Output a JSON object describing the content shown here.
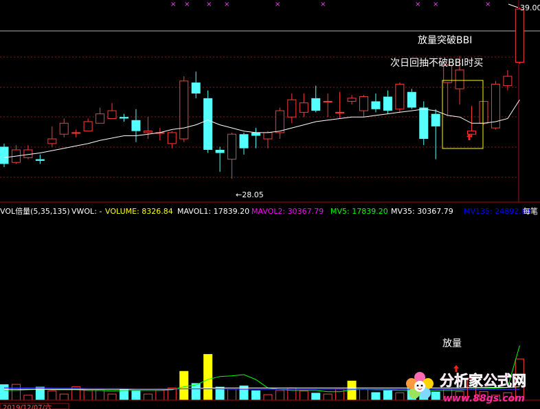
{
  "colors": {
    "up": "#ff3b3b",
    "down": "#54ffff",
    "bbi": "#ffffff",
    "vol_highlight": "#ffff00",
    "mavol1": "#ffffff",
    "mavol2": "#ff00ff",
    "mv5": "#00ff00",
    "mv35": "#ffffff",
    "mv135": "#0000ff",
    "label_yellow": "#ffff00",
    "annotation_box": "#ffff00",
    "signal_arrow": "#ff2020",
    "grid_dash": "#8a1a1a",
    "panel_border": "#a01010"
  },
  "price_panel": {
    "high_label": "39.00",
    "low_label": "←28.05",
    "top_markers": [
      "×",
      "×",
      "×",
      "×",
      "×",
      "×",
      "×",
      "×",
      "×"
    ],
    "annotation_breakout": "放量突破BBI",
    "annotation_pullback": "次日回抽不破BBI时买"
  },
  "volume_panel": {
    "indicator_name": "VOL倍量(5,35,135)",
    "legend": [
      {
        "text": "VWOL: -",
        "color": "#ffffff"
      },
      {
        "text": "VOLUME: 8326.84",
        "color": "#ffff00"
      },
      {
        "text": "MAVOL1: 17839.20",
        "color": "#ffffff"
      },
      {
        "text": "MAVOL2: 30367.79",
        "color": "#ff00ff"
      },
      {
        "text": "MV5: 17839.20",
        "color": "#00ff00"
      },
      {
        "text": "MV35: 30367.79",
        "color": "#ffffff"
      },
      {
        "text": "MV135: 24892.84",
        "color": "#0000ff"
      },
      {
        "text": "每笔",
        "color": "#ffffff"
      }
    ],
    "annotation_volume": "放量",
    "date_label": "2019/12/07/六"
  },
  "watermark": {
    "site_name": "分析家公式网",
    "site_url": "www.88gs.com"
  },
  "chart_data": [
    {
      "type": "candlestick",
      "title": "",
      "ylim": [
        27.0,
        39.3
      ],
      "x": [
        0,
        1,
        2,
        3,
        4,
        5,
        6,
        7,
        8,
        9,
        10,
        11,
        12,
        13,
        14,
        15,
        16,
        17,
        18,
        19,
        20,
        21,
        22,
        23,
        24,
        25,
        26,
        27,
        28,
        29,
        30,
        31,
        32,
        33,
        34,
        35,
        36,
        37,
        38,
        39,
        40,
        41,
        42,
        43
      ],
      "open": [
        30.1,
        29.1,
        29.4,
        29.3,
        30.3,
        30.9,
        31.0,
        31.1,
        31.6,
        31.9,
        32.0,
        31.8,
        31.0,
        31.0,
        30.3,
        30.6,
        34.2,
        33.2,
        29.9,
        29.3,
        30.9,
        31.0,
        30.6,
        31.0,
        32.0,
        32.3,
        33.2,
        33.0,
        32.3,
        33.0,
        32.4,
        33.0,
        33.3,
        32.5,
        33.6,
        32.6,
        32.2,
        34.2,
        33.8,
        30.9,
        31.6,
        31.3,
        34.0,
        35.5
      ],
      "close": [
        29.0,
        29.9,
        29.9,
        29.2,
        30.6,
        31.6,
        31.0,
        31.7,
        32.2,
        32.4,
        31.9,
        31.1,
        31.1,
        31.0,
        31.0,
        34.3,
        33.5,
        29.9,
        29.7,
        30.9,
        30.0,
        30.8,
        31.0,
        32.4,
        33.1,
        32.9,
        32.4,
        33.0,
        32.3,
        33.2,
        33.3,
        32.5,
        32.4,
        34.1,
        32.6,
        30.6,
        31.4,
        35.3,
        35.0,
        31.1,
        33.0,
        34.1,
        34.6,
        38.9
      ],
      "high": [
        30.3,
        30.2,
        30.2,
        29.6,
        31.4,
        31.9,
        31.2,
        31.9,
        32.6,
        32.9,
        32.2,
        32.5,
        32.0,
        31.3,
        31.1,
        34.6,
        34.9,
        33.7,
        30.1,
        31.0,
        31.0,
        31.3,
        31.1,
        32.6,
        33.5,
        33.5,
        34.0,
        33.5,
        33.6,
        33.4,
        33.4,
        33.5,
        33.7,
        34.2,
        33.8,
        33.0,
        32.5,
        35.4,
        35.9,
        32.7,
        33.0,
        34.3,
        35.0,
        39.0
      ],
      "low": [
        28.8,
        29.0,
        29.3,
        29.0,
        30.1,
        30.7,
        30.7,
        31.1,
        31.6,
        31.9,
        31.7,
        30.4,
        30.6,
        30.5,
        30.0,
        30.4,
        33.2,
        29.7,
        28.5,
        28.05,
        29.6,
        30.0,
        30.0,
        30.6,
        31.6,
        32.0,
        32.3,
        32.0,
        31.9,
        32.8,
        32.0,
        32.3,
        32.2,
        32.3,
        32.5,
        30.2,
        29.3,
        32.1,
        32.8,
        30.7,
        31.5,
        31.2,
        33.7,
        35.4
      ],
      "series": [
        {
          "name": "",
          "kind": "line",
          "values": [
            29.4,
            29.5,
            29.6,
            29.7,
            29.85,
            30.0,
            30.15,
            30.3,
            30.5,
            30.65,
            30.8,
            30.8,
            30.9,
            31.0,
            31.2,
            31.3,
            31.5,
            31.8,
            31.5,
            31.3,
            31.1,
            31.0,
            31.0,
            31.1,
            31.3,
            31.5,
            31.7,
            31.8,
            31.9,
            32.0,
            32.0,
            32.1,
            32.2,
            32.3,
            32.4,
            32.5,
            32.4,
            32.1,
            32.0,
            31.6,
            31.6,
            31.7,
            31.9,
            33.1
          ]
        }
      ],
      "annotations": [
        {
          "text": "放量突破BBI"
        },
        {
          "text": "次日回抽不破BBI时买"
        }
      ]
    },
    {
      "type": "bar",
      "title": "",
      "ylim": [
        0,
        30
      ],
      "x": [
        0,
        1,
        2,
        3,
        4,
        5,
        6,
        7,
        8,
        9,
        10,
        11,
        12,
        13,
        14,
        15,
        16,
        17,
        18,
        19,
        20,
        21,
        22,
        23,
        24,
        25,
        26,
        27,
        28,
        29,
        30,
        31,
        32,
        33,
        34,
        35,
        36,
        37,
        38,
        39,
        40,
        41,
        42,
        43
      ],
      "values": [
        2.6,
        2.6,
        0.8,
        2.2,
        1.5,
        1.0,
        2.2,
        1.6,
        1.6,
        1.0,
        1.8,
        1.6,
        1.0,
        1.6,
        2.0,
        4.8,
        2.8,
        7.6,
        2.2,
        1.8,
        2.4,
        1.6,
        0.9,
        1.6,
        2.0,
        1.5,
        1.2,
        1.0,
        1.8,
        3.2,
        1.8,
        1.3,
        1.6,
        1.2,
        2.4,
        1.5,
        1.4,
        1.8,
        1.4,
        3.6,
        1.4,
        0.8,
        1.2,
        6.8
      ],
      "highlight_indices": [
        15,
        17,
        29
      ],
      "series": [
        {
          "name": "MV5",
          "kind": "line",
          "values": [
            1.6,
            1.6,
            1.7,
            1.8,
            1.7,
            1.7,
            1.7,
            1.6,
            1.6,
            1.5,
            1.6,
            1.6,
            1.6,
            1.6,
            1.7,
            2.2,
            2.5,
            3.4,
            3.9,
            4.0,
            4.2,
            3.4,
            2.0,
            1.8,
            1.6,
            1.6,
            1.6,
            1.4,
            1.4,
            1.7,
            1.8,
            1.7,
            1.7,
            1.6,
            1.6,
            1.5,
            1.6,
            1.6,
            1.6,
            1.9,
            1.9,
            2.0,
            2.1,
            9.0
          ]
        },
        {
          "name": "MV35",
          "kind": "line",
          "values": [
            1.8,
            1.8,
            1.8,
            1.8,
            1.8,
            1.8,
            1.8,
            1.8,
            1.8,
            1.8,
            1.8,
            1.8,
            1.8,
            1.8,
            1.8,
            1.9,
            1.9,
            2.0,
            2.0,
            2.0,
            2.0,
            2.0,
            2.0,
            2.0,
            2.0,
            2.0,
            2.0,
            2.0,
            2.0,
            2.0,
            2.0,
            2.0,
            2.0,
            2.0,
            2.0,
            2.0,
            2.0,
            2.0,
            2.0,
            2.1,
            2.1,
            2.1,
            2.1,
            2.2
          ]
        },
        {
          "name": "MV135",
          "kind": "line",
          "values": [
            2.0,
            2.0,
            2.0,
            2.0,
            1.95,
            1.95,
            1.95,
            1.9,
            1.9,
            1.9,
            1.9,
            1.85,
            1.85,
            1.85,
            1.85,
            1.85,
            1.85,
            1.85,
            1.85,
            1.8,
            1.8,
            1.8,
            1.8,
            1.8,
            1.8,
            1.8,
            1.8,
            1.8,
            1.8,
            1.8,
            1.8,
            1.8,
            1.8,
            1.8,
            1.8,
            1.8,
            1.8,
            1.8,
            1.8,
            1.8,
            1.8,
            1.8,
            1.8,
            1.8
          ]
        }
      ]
    }
  ]
}
